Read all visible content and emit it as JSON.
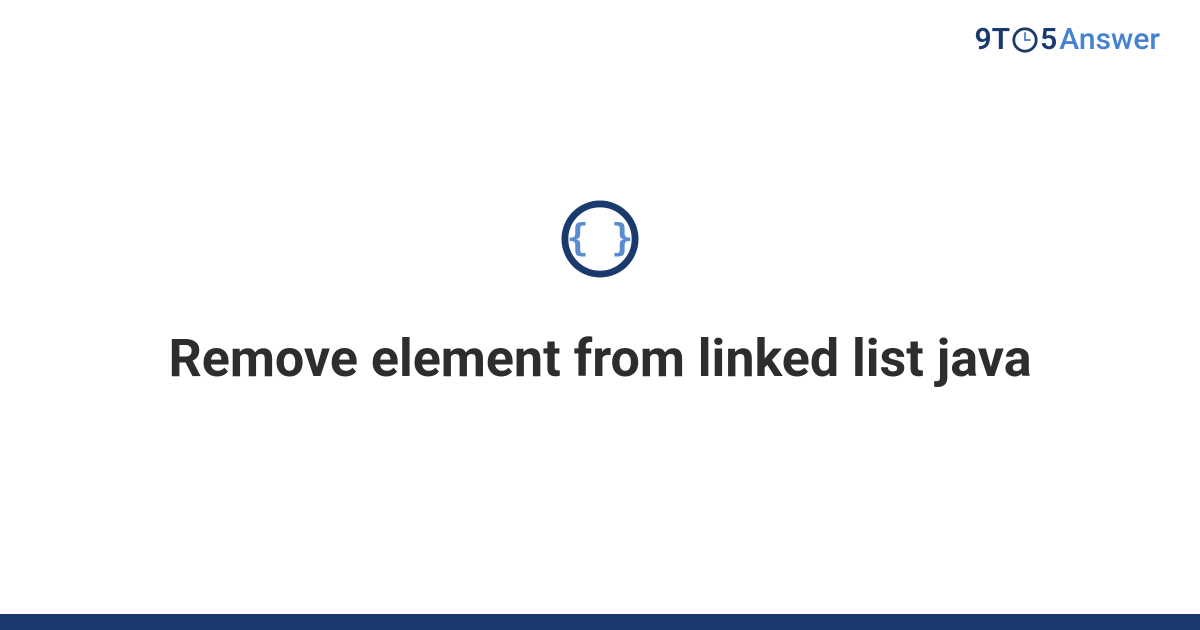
{
  "header": {
    "logo_9t": "9T",
    "logo_5": "5",
    "logo_answer": "Answer"
  },
  "main": {
    "title": "Remove element from linked list java",
    "icon_name": "code-braces-icon"
  },
  "colors": {
    "brand_dark": "#1a3a6e",
    "brand_light": "#5a8dd0",
    "text": "#2d2d2d"
  }
}
